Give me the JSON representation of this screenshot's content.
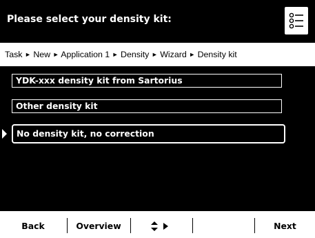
{
  "header": {
    "title": "Please select your density kit:",
    "menu_icon": "list-menu-icon"
  },
  "breadcrumb": {
    "items": [
      "Task",
      "New",
      "Application 1",
      "Density",
      "Wizard",
      "Density kit"
    ],
    "separator": "►"
  },
  "options": [
    {
      "label": "YDK-xxx density kit from Sartorius",
      "selected": false
    },
    {
      "label": "Other density kit",
      "selected": false
    },
    {
      "label": "No density kit, no correction",
      "selected": true
    }
  ],
  "softkeys": {
    "back": "Back",
    "overview": "Overview",
    "navigate_icons": [
      "up-down-arrows-icon",
      "right-arrow-icon"
    ],
    "empty": "",
    "next": "Next"
  },
  "colors": {
    "background": "#000000",
    "foreground": "#ffffff"
  }
}
